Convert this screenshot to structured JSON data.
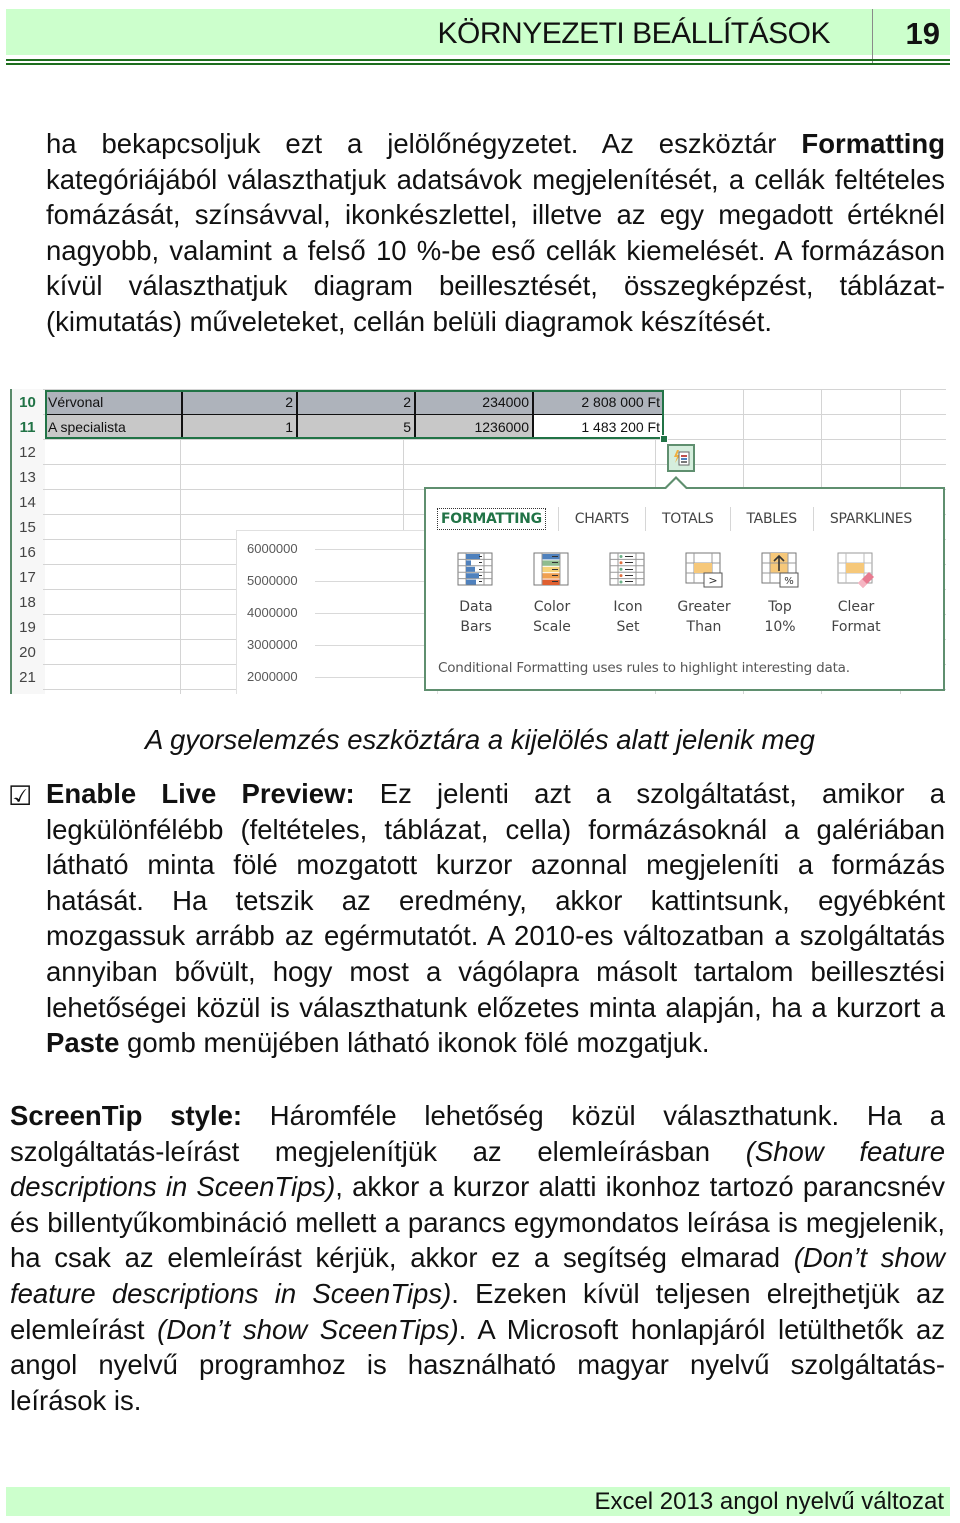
{
  "header": {
    "title": "KÖRNYEZETI BEÁLLÍTÁSOK",
    "page_number": "19"
  },
  "intro": {
    "t1": "ha bekapcsoljuk ezt a jelölőnégyzetet. Az eszköztár ",
    "b1": "Formatting",
    "t2": " kategóriájából választhatjuk adatsávok megjelenítését, a cellák feltételes fomázását, színsávval, ikonkészlettel, illetve az egy megadott értéknél nagyobb, valamint a felső 10 %-be eső cellák kiemelését. A formázáson kívül választhatjuk diagram beillesztését, összegképzést, táblázat- (kimutatás) műveleteket, cellán belüli diagramok készítését."
  },
  "spreadsheet": {
    "row_numbers": [
      "10",
      "11",
      "12",
      "13",
      "14",
      "15",
      "16",
      "17",
      "18",
      "19",
      "20",
      "21"
    ],
    "selected_rows": [
      "10",
      "11"
    ],
    "rows": [
      {
        "name": "Vérvonal",
        "c1": "2",
        "c2": "2",
        "c3": "234000",
        "total": "2 808 000 Ft"
      },
      {
        "name": "A specialista",
        "c1": "1",
        "c2": "5",
        "c3": "1236000",
        "total": "1 483 200 Ft"
      }
    ],
    "chart_axis_ticks": [
      "6000000",
      "5000000",
      "4000000",
      "3000000",
      "2000000"
    ],
    "quick_analysis": {
      "button_icon": "quick-analysis-icon",
      "tabs": [
        {
          "label": "FORMATTING",
          "active": true
        },
        {
          "label": "CHARTS",
          "active": false
        },
        {
          "label": "TOTALS",
          "active": false
        },
        {
          "label": "TABLES",
          "active": false
        },
        {
          "label": "SPARKLINES",
          "active": false
        }
      ],
      "tools": [
        {
          "label": "Data\nBars",
          "icon": "data-bars-icon"
        },
        {
          "label": "Color\nScale",
          "icon": "color-scale-icon"
        },
        {
          "label": "Icon\nSet",
          "icon": "icon-set-icon"
        },
        {
          "label": "Greater\nThan",
          "icon": "greater-than-icon"
        },
        {
          "label": "Top\n10%",
          "icon": "top-10-percent-icon"
        },
        {
          "label": "Clear\nFormat",
          "icon": "clear-format-icon"
        }
      ],
      "description": "Conditional Formatting uses rules to highlight interesting data."
    },
    "colors": {
      "accent_green": "#217346",
      "selected_row_fill": "#aeb3bb",
      "selected_cell_fill": "#c8c8c8"
    }
  },
  "caption": "A gyorselemzés eszköztára a kijelölés alatt jelenik meg",
  "live_preview": {
    "checkbox_glyph": "☑",
    "checked": true,
    "label": "Enable Live Preview:",
    "t1": " Ez jelenti azt a szolgáltatást, amikor a legkülönfélébb (feltételes, táblázat, cella) formázásoknál a galériában látható minta fölé mozgatott kurzor azonnal megjeleníti a formázás hatását. Ha tetszik az eredmény, akkor kattintsunk, egyébként mozgassuk arrább az egérmutatót. A 2010-es változatban a szolgáltatás annyiban bővült, hogy most a vágólapra másolt tartalom beillesztési lehetőségei közül is választhatunk előzetes minta alapján, ha a kurzort a ",
    "b1": "Paste",
    "t2": " gomb menüjében látható ikonok fölé mozgatjuk."
  },
  "screentip": {
    "label": "ScreenTip style:",
    "t1": " Háromféle lehetőség közül választhatunk. Ha a szolgáltatás-leírást megjelenítjük az elemleírásban ",
    "i1": "(Show feature descriptions in SceenTips)",
    "t2": ", akkor a kurzor alatti ikonhoz tartozó parancsnév és billentyűkombináció mellett a parancs egymondatos leírása is megjelenik, ha csak az elemleírást kérjük, akkor ez a segítség elmarad ",
    "i2": "(Don’t show feature descriptions in SceenTips)",
    "t3": ". Ezeken kívül teljesen elrejthetjük az elemleírást ",
    "i3": "(Don’t show SceenTips)",
    "t4": ". A Microsoft honlapjáról letülthetők az angol nyelvű programhoz is használható magyar nyelvű szolgáltatás-leírások is."
  },
  "footer": {
    "text": "Excel 2013 angol nyelvű változat"
  }
}
